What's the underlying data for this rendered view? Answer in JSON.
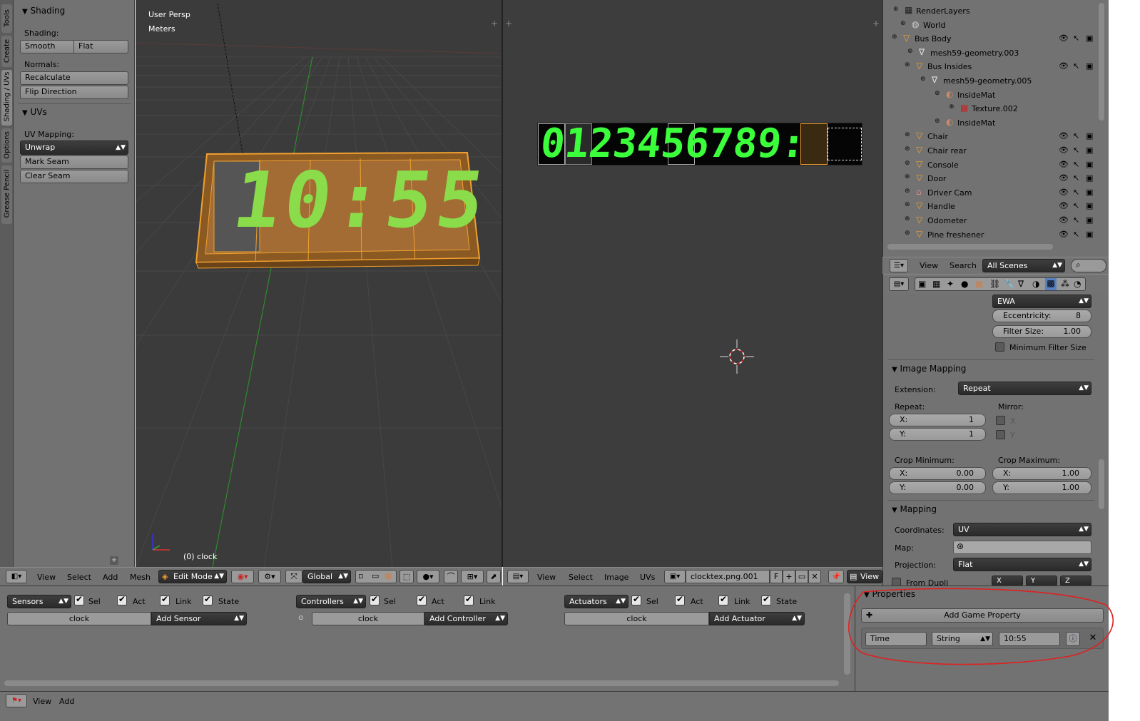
{
  "left_tabs": [
    "Tools",
    "Create",
    "Shading / UVs",
    "Options",
    "Grease Pencil"
  ],
  "tools_panel": {
    "shading_header": "Shading",
    "shading_label": "Shading:",
    "smooth": "Smooth",
    "flat": "Flat",
    "normals_label": "Normals:",
    "recalculate": "Recalculate",
    "flip_direction": "Flip Direction",
    "uvs_header": "UVs",
    "uv_mapping_label": "UV Mapping:",
    "unwrap": "Unwrap",
    "mark_seam": "Mark Seam",
    "clear_seam": "Clear Seam"
  },
  "viewport3d": {
    "view_name": "User Persp",
    "units": "Meters",
    "object_label": "(0) clock",
    "clock_text": "10:55"
  },
  "uv_editor": {
    "digits": [
      "0",
      "1",
      "2",
      "3",
      "4",
      "5",
      "6",
      "7",
      "8",
      "9",
      ":"
    ]
  },
  "outliner": {
    "items": [
      {
        "label": "RenderLayers",
        "icon": "renderlayers-icon"
      },
      {
        "label": "World",
        "icon": "world-icon"
      },
      {
        "label": "Bus Body",
        "icon": "mesh-object-icon"
      },
      {
        "label": "mesh59-geometry.003",
        "icon": "mesh-data-icon"
      },
      {
        "label": "Bus Insides",
        "icon": "mesh-object-icon"
      },
      {
        "label": "mesh59-geometry.005",
        "icon": "mesh-data-icon"
      },
      {
        "label": "InsideMat",
        "icon": "material-icon"
      },
      {
        "label": "Texture.002",
        "icon": "texture-icon"
      },
      {
        "label": "InsideMat",
        "icon": "material-icon"
      },
      {
        "label": "Chair",
        "icon": "mesh-object-icon"
      },
      {
        "label": "Chair rear",
        "icon": "mesh-object-icon"
      },
      {
        "label": "Console",
        "icon": "mesh-object-icon"
      },
      {
        "label": "Door",
        "icon": "mesh-object-icon"
      },
      {
        "label": "Driver Cam",
        "icon": "camera-icon"
      },
      {
        "label": "Handle",
        "icon": "mesh-object-icon"
      },
      {
        "label": "Odometer",
        "icon": "mesh-object-icon"
      },
      {
        "label": "Pine freshener",
        "icon": "mesh-object-icon"
      }
    ],
    "header": {
      "view": "View",
      "search": "Search",
      "scene_select": "All Scenes"
    }
  },
  "properties": {
    "filter_type": "EWA",
    "eccentricity_label": "Eccentricity:",
    "eccentricity_value": "8",
    "filter_size_label": "Filter Size:",
    "filter_size_value": "1.00",
    "min_filter_size": "Minimum Filter Size",
    "image_mapping_header": "Image Mapping",
    "extension_label": "Extension:",
    "extension_value": "Repeat",
    "repeat_label": "Repeat:",
    "mirror_label": "Mirror:",
    "repeat_x_label": "X:",
    "repeat_x": "1",
    "repeat_y_label": "Y:",
    "repeat_y": "1",
    "mirror_x": "X",
    "mirror_y": "Y",
    "crop_min_label": "Crop Minimum:",
    "crop_max_label": "Crop Maximum:",
    "crop_min_x_label": "X:",
    "crop_min_x": "0.00",
    "crop_min_y_label": "Y:",
    "crop_min_y": "0.00",
    "crop_max_x_label": "X:",
    "crop_max_x": "1.00",
    "crop_max_y_label": "Y:",
    "crop_max_y": "1.00",
    "mapping_header": "Mapping",
    "coordinates_label": "Coordinates:",
    "coordinates_value": "UV",
    "map_label": "Map:",
    "projection_label": "Projection:",
    "projection_value": "Flat",
    "from_dupli": "From Dupli",
    "x_btn": "X",
    "y_btn": "Y",
    "z_btn": "Z"
  },
  "header3d": {
    "view": "View",
    "select": "Select",
    "add": "Add",
    "mesh": "Mesh",
    "mode": "Edit Mode",
    "orientation": "Global"
  },
  "header_uv": {
    "view": "View",
    "select": "Select",
    "image": "Image",
    "uvs": "UVs",
    "image_name": "clocktex.png.001",
    "fake_user": "F",
    "view2": "View"
  },
  "logic": {
    "sensors": "Sensors",
    "controllers": "Controllers",
    "actuators": "Actuators",
    "sel": "Sel",
    "act": "Act",
    "link": "Link",
    "state": "State",
    "object_name": "clock",
    "add_sensor": "Add Sensor",
    "add_controller": "Add Controller",
    "add_actuator": "Add Actuator"
  },
  "game_properties": {
    "header": "Properties",
    "add_button": "Add Game Property",
    "name": "Time",
    "type": "String",
    "value": "10:55"
  },
  "bottom_header": {
    "view": "View",
    "add": "Add"
  },
  "colors": {
    "accent": "#f0a030",
    "digit_green": "#3cff3c",
    "annotation_red": "#e02020"
  }
}
